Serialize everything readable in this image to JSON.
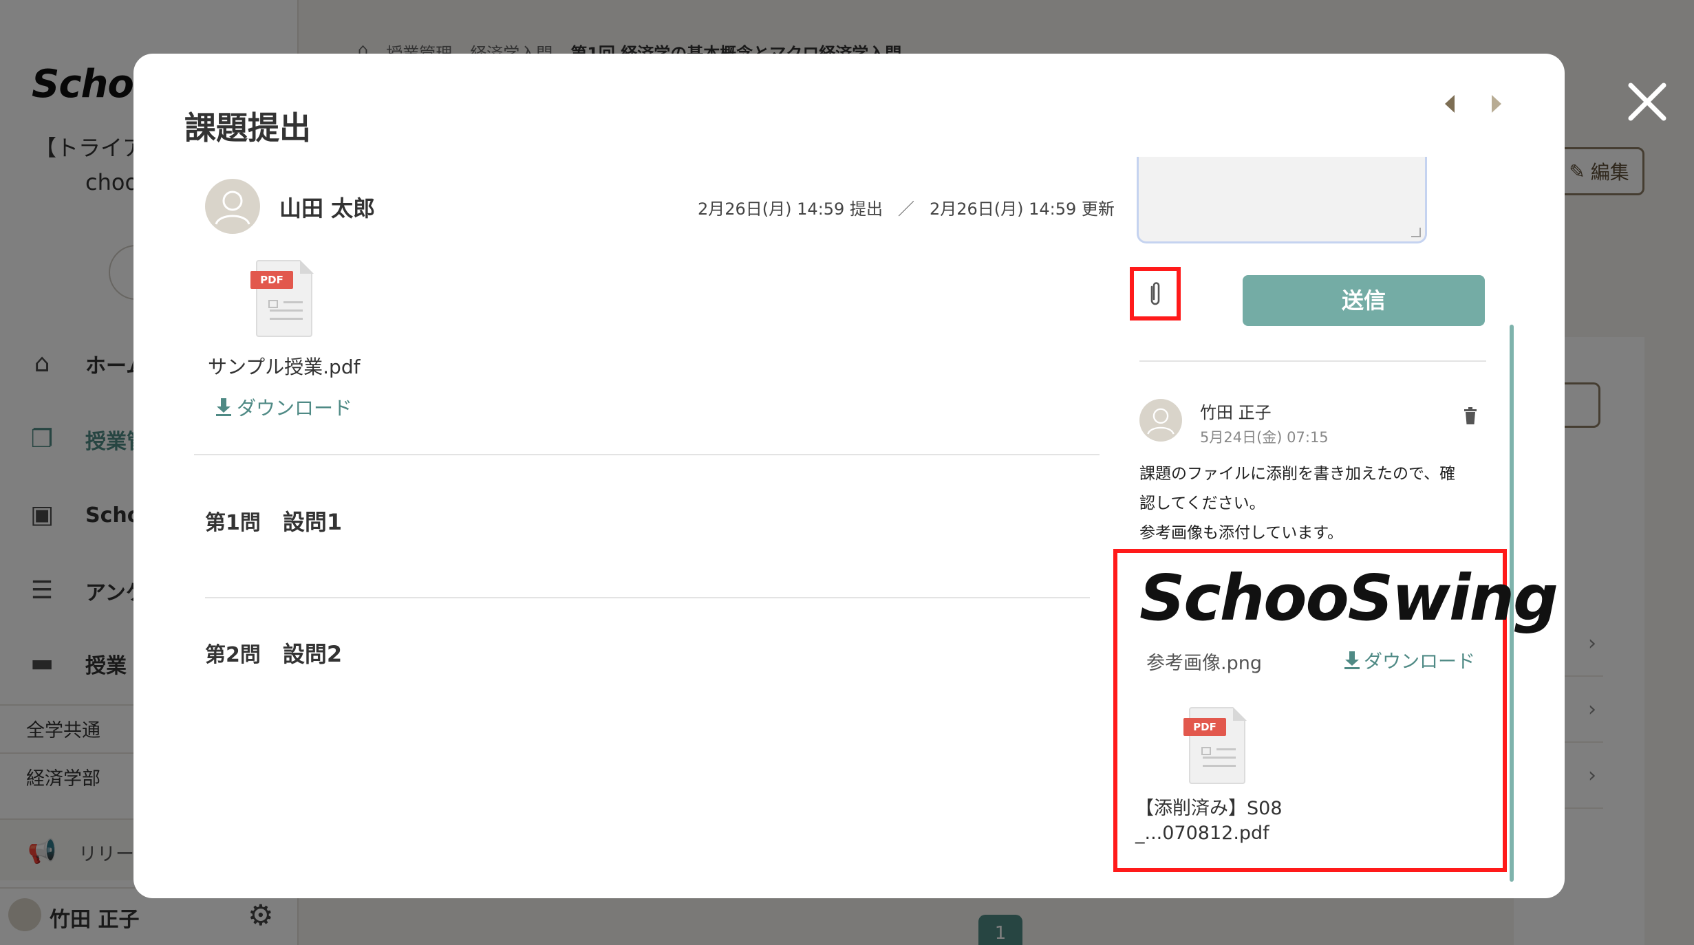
{
  "background": {
    "logo": "Schoo",
    "org_name": "【トライア",
    "org_sub": "choo",
    "nav": [
      {
        "label": "ホーム",
        "icon": "home-icon"
      },
      {
        "label": "授業管",
        "icon": "class-management-icon"
      },
      {
        "label": "Scho",
        "icon": "tv-icon"
      },
      {
        "label": "アンケ",
        "icon": "survey-icon"
      },
      {
        "label": "授業",
        "icon": "folder-icon"
      }
    ],
    "sub_items": [
      "全学共通",
      "経済学部"
    ],
    "release_label": "リリー",
    "user_name": "竹田 正子",
    "breadcrumb": [
      "授業管理",
      "経済学入門",
      "第1回 経済学の基本概念とマクロ経済学入門"
    ],
    "edit_label": "編集",
    "page_number": "1"
  },
  "modal": {
    "title": "課題提出",
    "submitter": {
      "name": "山田 太郎",
      "submitted": "2月26日(月) 14:59 提出",
      "separator": "／",
      "updated": "2月26日(月) 14:59 更新"
    },
    "file": {
      "badge": "PDF",
      "name": "サンプル授業.pdf",
      "download_label": "ダウンロード"
    },
    "questions": [
      {
        "number": "第1問",
        "title": "設問1"
      },
      {
        "number": "第2問",
        "title": "設問2"
      }
    ],
    "send_label": "送信",
    "comment": {
      "author": "竹田 正子",
      "date": "5月24日(金) 07:15",
      "lines": [
        "課題のファイルに添削を書き加えたので、確",
        "認してください。",
        "参考画像も添付しています。"
      ],
      "image_logo": "SchooSwing",
      "image_name": "参考画像.png",
      "image_download_label": "ダウンロード",
      "pdf_badge": "PDF",
      "pdf_name_line1": "【添削済み】S08",
      "pdf_name_line2": "_...070812.pdf"
    }
  },
  "colors": {
    "accent": "#4f8a85",
    "send_button": "#74aca5",
    "highlight": "#ff1a1a",
    "pdf_tag": "#e2584d"
  }
}
